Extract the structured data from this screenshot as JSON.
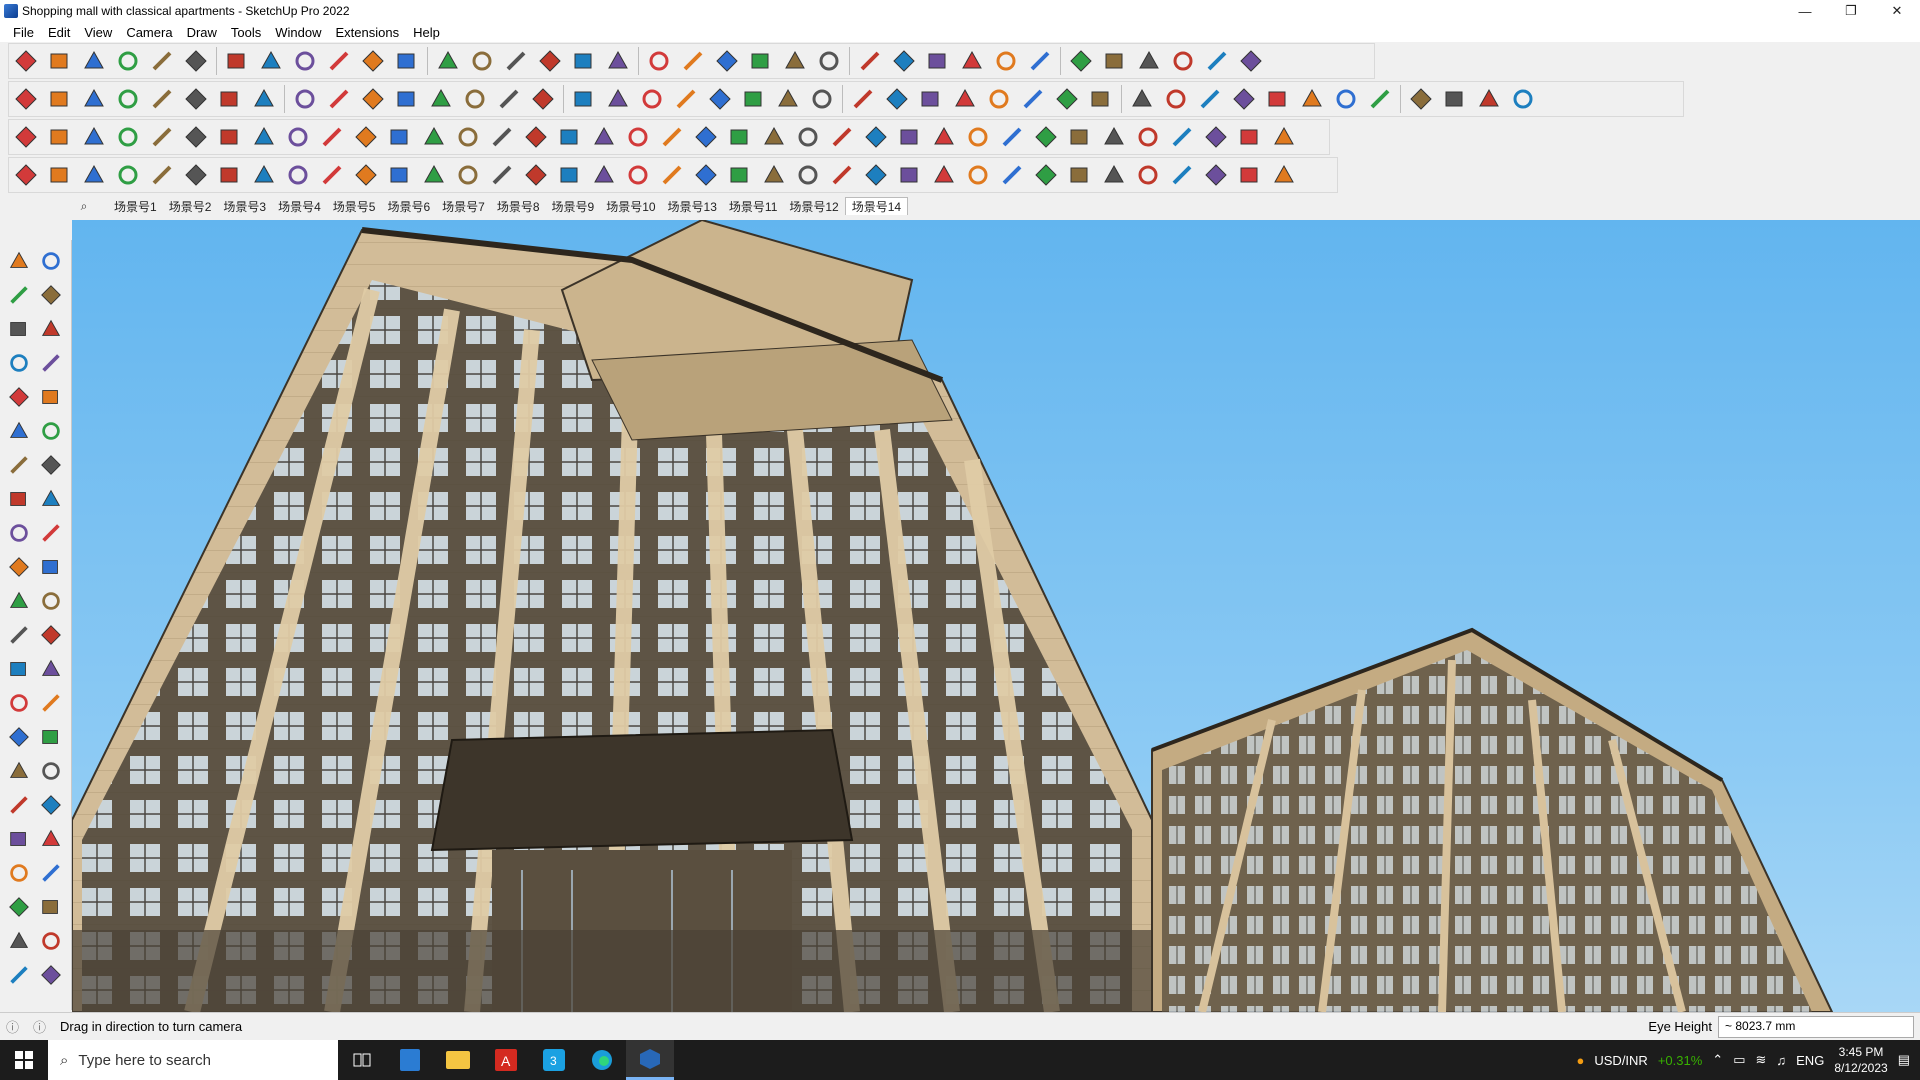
{
  "window": {
    "title": "Shopping mall with classical apartments - SketchUp Pro 2022",
    "minimize": "—",
    "restore": "❐",
    "close": "✕"
  },
  "menu": [
    "File",
    "Edit",
    "View",
    "Camera",
    "Draw",
    "Tools",
    "Window",
    "Extensions",
    "Help"
  ],
  "scenes": {
    "active_index": 13,
    "tabs": [
      "场景号1",
      "场景号2",
      "场景号3",
      "场景号4",
      "场景号5",
      "场景号6",
      "场景号7",
      "场景号8",
      "场景号9",
      "场景号10",
      "场景号13",
      "场景号11",
      "场景号12",
      "场景号14"
    ]
  },
  "status": {
    "hint": "Drag in direction to turn camera",
    "vcb_label": "Eye Height",
    "vcb_value": "~ 8023.7 mm"
  },
  "taskbar": {
    "search_placeholder": "Type here to search",
    "currency": "USD/INR",
    "currency_change": "+0.31%",
    "language": "ENG",
    "time": "3:45 PM",
    "date": "8/12/2023"
  },
  "colors": {
    "sky_top": "#62b5ef",
    "facade": "#d2bc98",
    "window_dark": "#4a4236",
    "glass": "#c9d8e4",
    "accent_green": "#38b000",
    "taskbar": "#1c1c1c"
  }
}
